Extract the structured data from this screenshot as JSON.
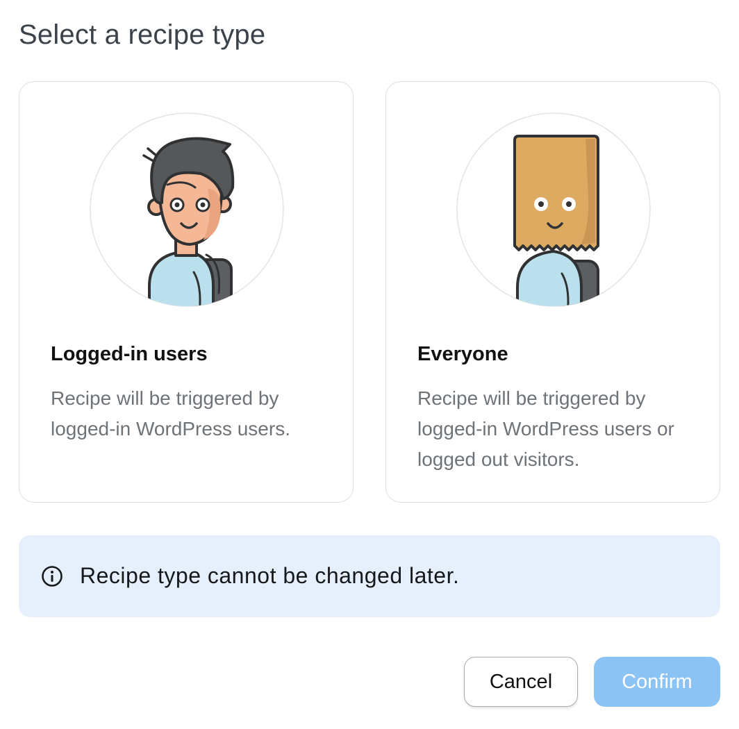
{
  "dialog": {
    "title": "Select a recipe type"
  },
  "options": [
    {
      "title": "Logged-in users",
      "description": "Recipe will be triggered by logged-in WordPress users.",
      "illustration": "user-avatar-icon"
    },
    {
      "title": "Everyone",
      "description": "Recipe will be triggered by logged-in WordPress users or logged out visitors.",
      "illustration": "paper-bag-avatar-icon"
    }
  ],
  "notice": {
    "icon": "info-icon",
    "text": "Recipe type cannot be changed later."
  },
  "actions": {
    "cancel_label": "Cancel",
    "confirm_label": "Confirm",
    "confirm_color": "#8cc3f5"
  }
}
